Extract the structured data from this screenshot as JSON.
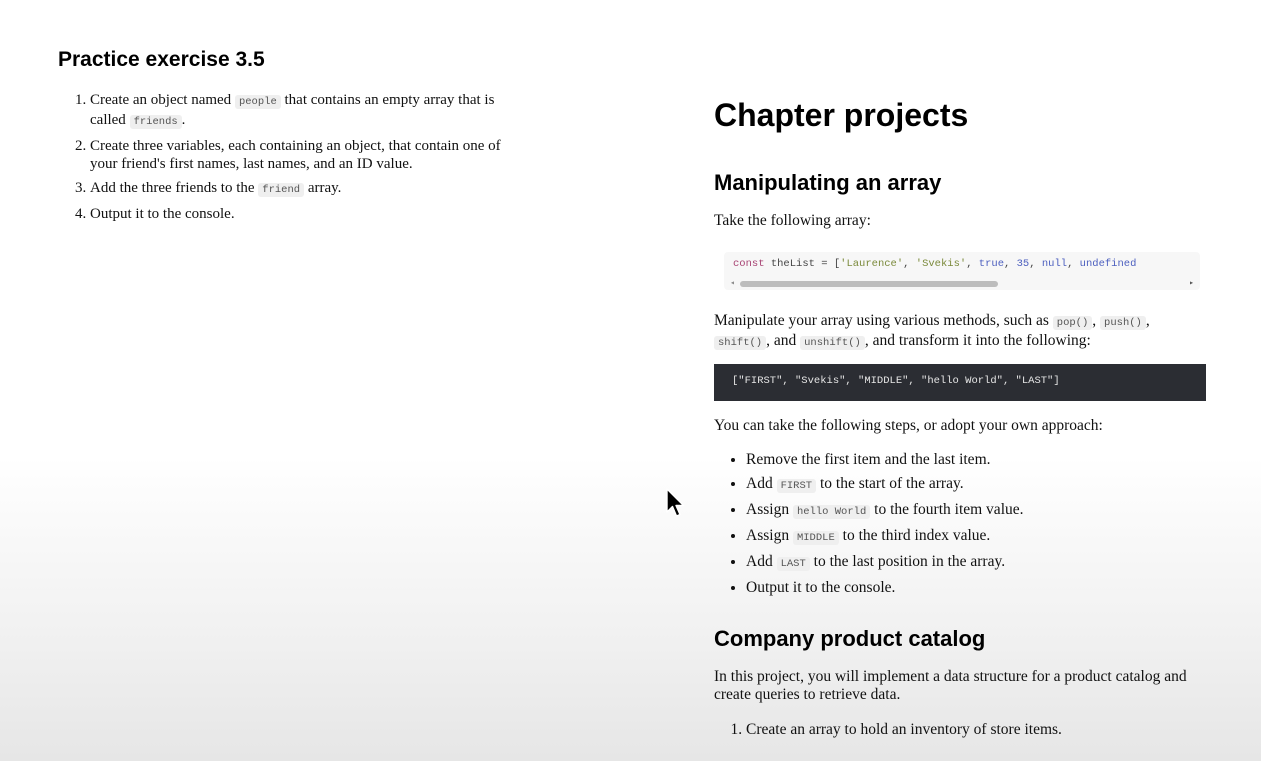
{
  "practice": {
    "title": "Practice exercise 3.5",
    "items": [
      {
        "a": "Create an object named ",
        "code": "people",
        "b": " that contains an empty array that is called ",
        "code2": "friends",
        "c": "."
      },
      {
        "text": "Create three variables, each containing an object, that contain one of your friend's first names, last names, and an ID value."
      },
      {
        "a": "Add the three friends to the ",
        "code": "friend",
        "b": " array."
      },
      {
        "text": "Output it to the console."
      }
    ]
  },
  "chapter": {
    "title": "Chapter projects",
    "array_section": {
      "title": "Manipulating an array",
      "intro": "Take the following array:",
      "code_line": {
        "kw": "const",
        "name": " theList = [",
        "s1": "'Laurence'",
        "sep1": ", ",
        "s2": "'Svekis'",
        "sep2": ", ",
        "v_true": "true",
        "sep3": ", ",
        "v_num": "35",
        "sep4": ", ",
        "v_null": "null",
        "sep5": ", ",
        "v_undef": "undefined"
      },
      "para_a": "Manipulate your array using various methods, such as ",
      "m_pop": "pop()",
      "sep_a": ", ",
      "m_push": "push()",
      "sep_b": ", ",
      "m_shift": "shift()",
      "sep_c": ", and ",
      "m_unshift": "unshift()",
      "para_b": ", and transform it into the following:",
      "result_code": "[\"FIRST\", \"Svekis\", \"MIDDLE\", \"hello World\", \"LAST\"]",
      "steps_intro": "You can take the following steps, or adopt your own approach:",
      "steps": [
        {
          "a": "Remove the first item and the last item."
        },
        {
          "a": "Add ",
          "code": "FIRST",
          "b": " to the start of the array."
        },
        {
          "a": "Assign ",
          "code": "hello World",
          "b": " to the fourth item value."
        },
        {
          "a": "Assign ",
          "code": "MIDDLE",
          "b": " to the third index value."
        },
        {
          "a": "Add ",
          "code": "LAST",
          "b": " to the last position in the array."
        },
        {
          "a": "Output it to the console."
        }
      ]
    },
    "catalog_section": {
      "title": "Company product catalog",
      "intro": "In this project, you will implement a data structure for a product catalog and create queries to retrieve data.",
      "items": [
        "Create an array to hold an inventory of store items."
      ]
    }
  },
  "scroll_arrows": {
    "left": "◂",
    "right": "▸"
  }
}
